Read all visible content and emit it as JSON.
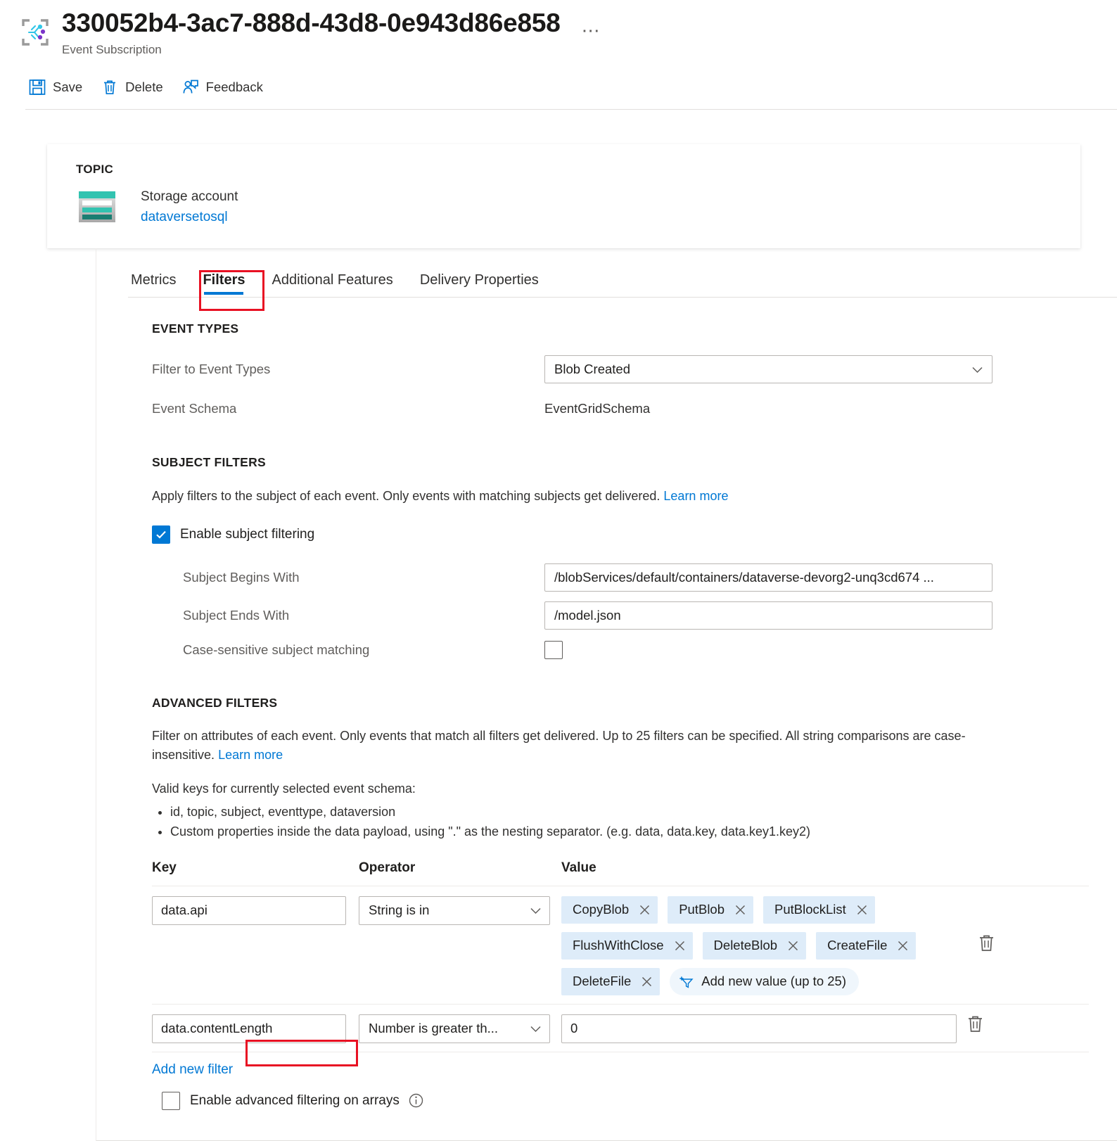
{
  "header": {
    "title": "330052b4-3ac7-888d-43d8-0e943d86e858",
    "subtitle": "Event Subscription",
    "ellipsis": "⋯",
    "resource_icon": "event-grid-subscription-icon"
  },
  "commandbar": {
    "save_label": "Save",
    "delete_label": "Delete",
    "feedback_label": "Feedback"
  },
  "topic": {
    "label": "TOPIC",
    "kind": "Storage account",
    "name": "dataversetosql",
    "icon": "storage-account-icon"
  },
  "tabs": [
    {
      "label": "Metrics",
      "active": false
    },
    {
      "label": "Filters",
      "active": true
    },
    {
      "label": "Additional Features",
      "active": false
    },
    {
      "label": "Delivery Properties",
      "active": false
    }
  ],
  "event_types": {
    "heading": "EVENT TYPES",
    "filter_label": "Filter to Event Types",
    "filter_value": "Blob Created",
    "schema_label": "Event Schema",
    "schema_value": "EventGridSchema"
  },
  "subject_filters": {
    "heading": "SUBJECT FILTERS",
    "description": "Apply filters to the subject of each event. Only events with matching subjects get delivered.",
    "learn_more": "Learn more",
    "enable_label": "Enable subject filtering",
    "enable_checked": true,
    "begins_label": "Subject Begins With",
    "begins_value": "/blobServices/default/containers/dataverse-devorg2-unq3cd674 ...",
    "ends_label": "Subject Ends With",
    "ends_value": "/model.json",
    "case_label": "Case-sensitive subject matching",
    "case_checked": false
  },
  "advanced_filters": {
    "heading": "ADVANCED FILTERS",
    "description": "Filter on attributes of each event. Only events that match all filters get delivered. Up to 25 filters can be specified. All string comparisons are case-insensitive.",
    "learn_more": "Learn more",
    "valid_keys_intro": "Valid keys for currently selected event schema:",
    "valid_keys": [
      "id, topic, subject, eventtype, dataversion",
      "Custom properties inside the data payload, using \".\" as the nesting separator. (e.g. data, data.key, data.key1.key2)"
    ],
    "columns": {
      "key": "Key",
      "operator": "Operator",
      "value": "Value"
    },
    "rows": [
      {
        "key": "data.api",
        "operator": "String is in",
        "type": "chips",
        "chips": [
          "CopyBlob",
          "PutBlob",
          "PutBlockList",
          "FlushWithClose",
          "DeleteBlob",
          "CreateFile",
          "DeleteFile"
        ],
        "add_value_label": "Add new value (up to 25)"
      },
      {
        "key": "data.contentLength",
        "operator": "Number is greater th...",
        "type": "text",
        "value": "0"
      }
    ],
    "add_filter_label": "Add new filter",
    "arrays_label": "Enable advanced filtering on arrays",
    "arrays_checked": false
  },
  "colors": {
    "accent": "#0078d4",
    "annotation": "#e81123",
    "chip_bg": "#deecf9",
    "pill_bg": "#eff6fc",
    "storage_teal": "#32c3b0",
    "storage_dark_teal": "#1a7e72"
  }
}
